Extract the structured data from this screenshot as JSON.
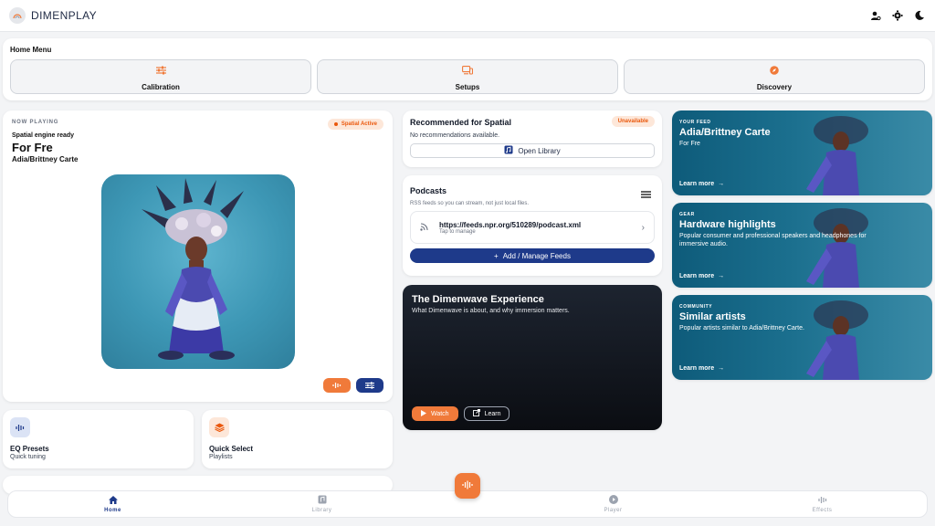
{
  "app": {
    "brand": "DIMENPLAY"
  },
  "home_menu": {
    "title": "Home Menu",
    "items": [
      {
        "label": "Calibration",
        "icon": "sliders-icon"
      },
      {
        "label": "Setups",
        "icon": "devices-icon"
      },
      {
        "label": "Discovery",
        "icon": "compass-icon"
      }
    ]
  },
  "now_playing": {
    "label": "NOW PLAYING",
    "badge": "Spatial Active",
    "status": "Spatial engine ready",
    "title": "For Fre",
    "artist": "Adia/Brittney Carte"
  },
  "small_cards": [
    {
      "title": "EQ Presets",
      "subtitle": "Quick tuning",
      "icon": "equalizer-icon"
    },
    {
      "title": "Quick Select",
      "subtitle": "Playlists",
      "icon": "layers-icon"
    }
  ],
  "recommended": {
    "title": "Recommended for Spatial",
    "badge": "Unavailable",
    "message": "No recommendations available.",
    "button": "Open Library"
  },
  "podcasts": {
    "title": "Podcasts",
    "subtitle": "RSS feeds so you can stream, not just local files.",
    "feed_url": "https://feeds.npr.org/510289/podcast.xml",
    "feed_meta": "Tap to manage",
    "add_button": "Add / Manage Feeds"
  },
  "dimenwave": {
    "title": "The Dimenwave Experience",
    "subtitle": "What Dimenwave is about, and why immersion matters.",
    "watch": "Watch",
    "learn": "Learn"
  },
  "tiles": [
    {
      "kicker": "YOUR FEED",
      "title": "Adia/Brittney Carte",
      "desc": "For Fre",
      "cta": "Learn more"
    },
    {
      "kicker": "GEAR",
      "title": "Hardware highlights",
      "desc": "Popular consumer and professional speakers and headphones for immersive audio.",
      "cta": "Learn more"
    },
    {
      "kicker": "COMMUNITY",
      "title": "Similar artists",
      "desc": "Popular artists similar to Adia/Brittney Carte.",
      "cta": "Learn more"
    }
  ],
  "nav": {
    "items": [
      {
        "label": "Home",
        "active": true
      },
      {
        "label": "Library",
        "active": false
      },
      {
        "label": "Player",
        "active": false
      },
      {
        "label": "Effects",
        "active": false
      }
    ]
  },
  "colors": {
    "accent": "#f07a3a",
    "primary": "#1e3a8a",
    "tile": "#1b6f8e"
  }
}
